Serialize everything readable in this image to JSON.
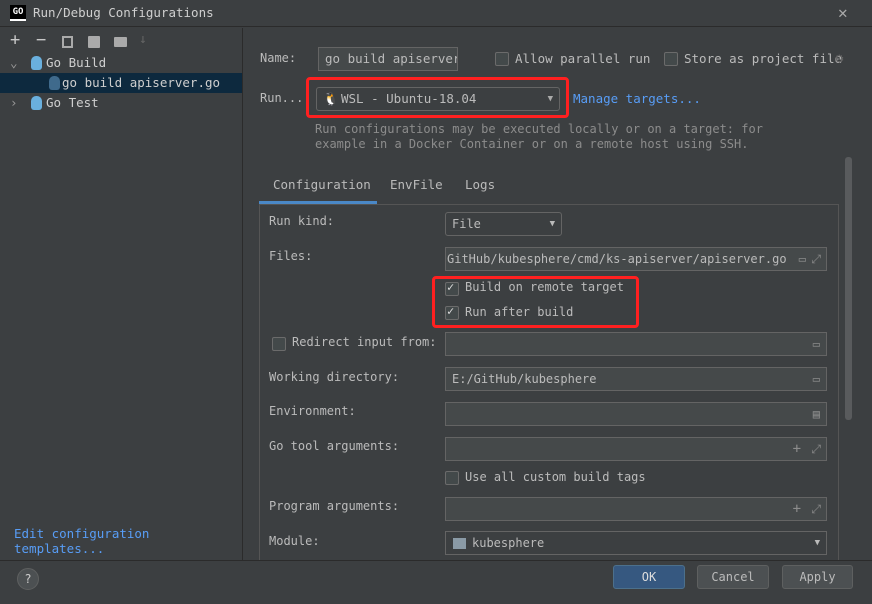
{
  "window": {
    "title": "Run/Debug Configurations",
    "app_icon": "GO"
  },
  "toolbar": {
    "add": "+",
    "remove": "−",
    "copy": "copy-icon",
    "save": "save-icon",
    "folder": "new-folder-icon",
    "sort": "sort-icon"
  },
  "tree": [
    {
      "label": "Go Build",
      "expanded": true
    },
    {
      "label": "go build apiserver.go",
      "selected": true
    },
    {
      "label": "Go Test",
      "expanded": false
    }
  ],
  "edit_templates": "Edit configuration templates...",
  "name": {
    "label": "Name:",
    "value": "go build apiserver."
  },
  "allow_parallel": {
    "label": "Allow parallel run",
    "checked": false
  },
  "store_project": {
    "label": "Store as project file",
    "checked": false
  },
  "run_on": {
    "label": "Run...",
    "value": "WSL - Ubuntu-18.04",
    "manage": "Manage targets...",
    "hint1": "Run configurations may be executed locally or on a target: for",
    "hint2": "example in a Docker Container or on a remote host using SSH."
  },
  "tabs": [
    "Configuration",
    "EnvFile",
    "Logs"
  ],
  "form": {
    "run_kind": {
      "label": "Run kind:",
      "value": "File"
    },
    "files": {
      "label": "Files:",
      "value": "GitHub/kubesphere/cmd/ks-apiserver/apiserver.go"
    },
    "build_remote": {
      "label": "Build on remote target",
      "checked": true
    },
    "run_after": {
      "label": "Run after build",
      "checked": true
    },
    "redirect": {
      "label": "Redirect input from:",
      "checked": false,
      "value": ""
    },
    "working_dir": {
      "label": "Working directory:",
      "value": "E:/GitHub/kubesphere"
    },
    "environment": {
      "label": "Environment:",
      "value": ""
    },
    "go_tool": {
      "label": "Go tool arguments:",
      "value": ""
    },
    "custom_tags": {
      "label": "Use all custom build tags",
      "checked": false
    },
    "program_args": {
      "label": "Program arguments:",
      "value": ""
    },
    "module": {
      "label": "Module:",
      "value": "kubesphere"
    }
  },
  "buttons": {
    "ok": "OK",
    "cancel": "Cancel",
    "apply": "Apply",
    "help": "?"
  },
  "colors": {
    "accent": "#589df6",
    "selection": "#0d293e",
    "highlight": "#ff2020",
    "ok": "#365880"
  }
}
